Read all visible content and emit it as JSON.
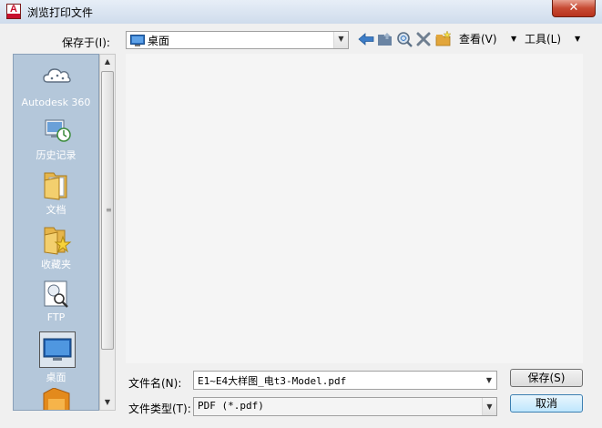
{
  "window": {
    "title": "浏览打印文件",
    "app_icon_letter": "A",
    "close_glyph": "✕"
  },
  "toolbar": {
    "save_in_label": "保存于(I):",
    "location": "桌面",
    "views_label": "查看(V)",
    "tools_label": "工具(L)",
    "icons": [
      "back-arrow-icon",
      "up-folder-icon",
      "search-web-icon",
      "delete-icon",
      "new-folder-icon",
      "views-dropdown-icon",
      "tools-dropdown-icon"
    ]
  },
  "places": [
    {
      "label": "Autodesk 360",
      "icon": "cloud-icon"
    },
    {
      "label": "历史记录",
      "icon": "history-icon"
    },
    {
      "label": "文档",
      "icon": "documents-folder-icon"
    },
    {
      "label": "收藏夹",
      "icon": "favorites-folder-icon"
    },
    {
      "label": "FTP",
      "icon": "ftp-icon"
    },
    {
      "label": "桌面",
      "icon": "desktop-icon",
      "selected": true
    }
  ],
  "form": {
    "filename_label": "文件名(N):",
    "filename_value": "E1~E4大样图_电t3-Model.pdf",
    "filetype_label": "文件类型(T):",
    "filetype_value": "PDF (*.pdf)"
  },
  "buttons": {
    "save": "保存(S)",
    "cancel": "取消"
  },
  "colors": {
    "places_bg": "#b4c7da",
    "close_red": "#c74a33",
    "default_button": "#bee6fd"
  }
}
